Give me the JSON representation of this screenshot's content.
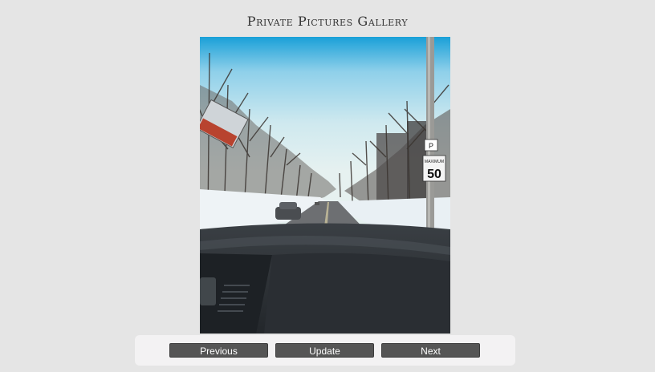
{
  "gallery": {
    "title": "Private Pictures Gallery",
    "image_alt": "",
    "sign_top": "P",
    "sign_label": "MAXIMUM",
    "sign_value": "50"
  },
  "controls": {
    "previous_label": "Previous",
    "update_label": "Update",
    "next_label": "Next"
  },
  "colors": {
    "page_background": "#e5e5e5",
    "button_background": "#555555",
    "button_text": "#ffffff",
    "controls_background": "#f3f2f3"
  }
}
